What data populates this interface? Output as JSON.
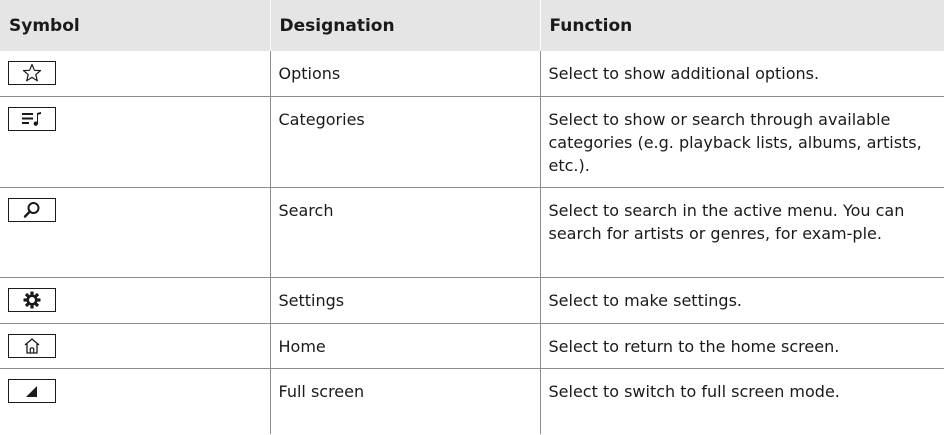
{
  "table": {
    "headers": {
      "symbol": "Symbol",
      "designation": "Designation",
      "function": "Function"
    },
    "rows": [
      {
        "icon": "star-outline-icon",
        "designation": "Options",
        "function": "Select to show additional options."
      },
      {
        "icon": "music-list-icon",
        "designation": "Categories",
        "function": "Select to show or search through available categories (e.g. playback lists, albums, artists, etc.)."
      },
      {
        "icon": "search-icon",
        "designation": "Search",
        "function": "Select to search in the active menu. You can search for artists or genres, for exam-ple."
      },
      {
        "icon": "gear-icon",
        "designation": "Settings",
        "function": "Select to make settings."
      },
      {
        "icon": "home-icon",
        "designation": "Home",
        "function": "Select to return to the home screen."
      },
      {
        "icon": "full-screen-icon",
        "designation": "Full screen",
        "function": "Select to switch to full screen mode."
      }
    ]
  }
}
